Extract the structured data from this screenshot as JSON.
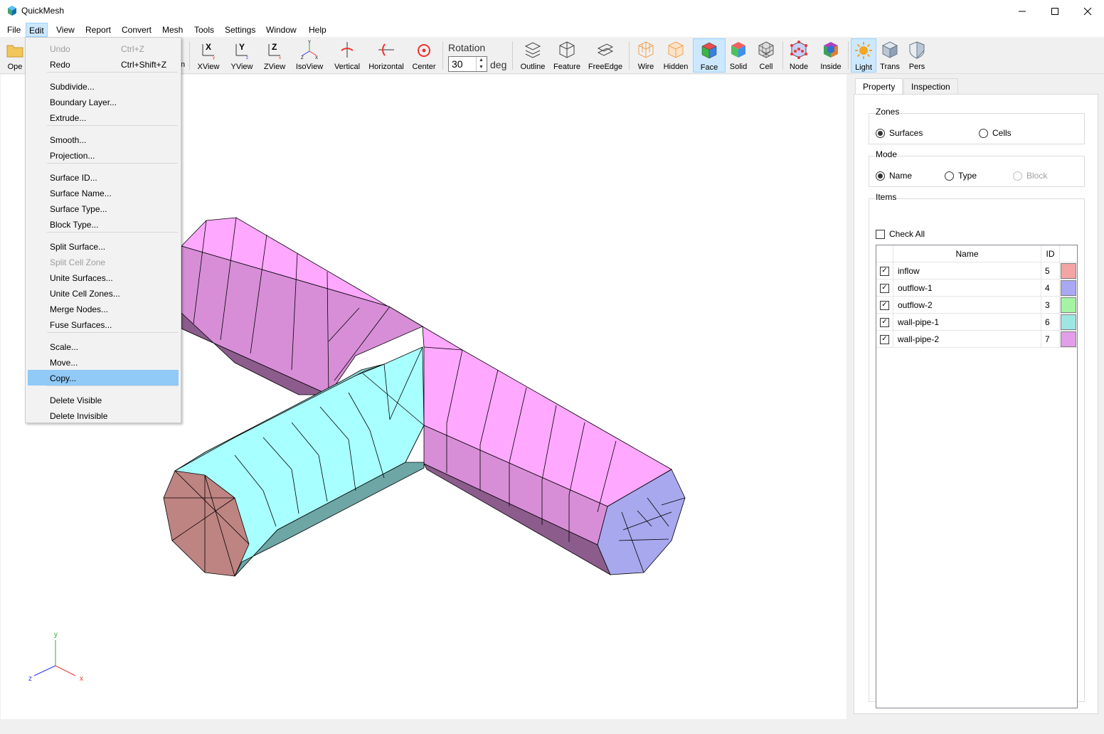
{
  "window": {
    "title": "QuickMesh",
    "controls": [
      "minimize",
      "maximize",
      "close"
    ]
  },
  "menubar": [
    "File",
    "Edit",
    "View",
    "Report",
    "Convert",
    "Mesh",
    "Tools",
    "Settings",
    "Window",
    "Help"
  ],
  "open_menu": "Edit",
  "toolbar": {
    "hidden_open_label": "Ope",
    "hidden_fragment": "n",
    "view_tools": [
      "XView",
      "YView",
      "ZView",
      "IsoView",
      "Vertical",
      "Horizontal",
      "Center"
    ],
    "rotation": {
      "label": "Rotation",
      "value": "30",
      "unit": "deg"
    },
    "display_tools": [
      "Outline",
      "Feature",
      "FreeEdge",
      "Wire",
      "Hidden",
      "Face",
      "Solid",
      "Cell",
      "Node",
      "Inside",
      "Light",
      "Trans",
      "Pers"
    ],
    "active_tools": [
      "Face",
      "Light"
    ]
  },
  "edit_menu": {
    "items": [
      {
        "label": "Undo",
        "shortcut": "Ctrl+Z",
        "disabled": true
      },
      {
        "label": "Redo",
        "shortcut": "Ctrl+Shift+Z"
      },
      {
        "label": "Subdivide..."
      },
      {
        "label": "Boundary Layer..."
      },
      {
        "label": "Extrude..."
      },
      {
        "label": "Smooth..."
      },
      {
        "label": "Projection..."
      },
      {
        "label": "Surface ID..."
      },
      {
        "label": "Surface Name..."
      },
      {
        "label": "Surface Type..."
      },
      {
        "label": "Block Type..."
      },
      {
        "label": "Split Surface..."
      },
      {
        "label": "Split Cell Zone",
        "disabled": true
      },
      {
        "label": "Unite Surfaces..."
      },
      {
        "label": "Unite Cell Zones..."
      },
      {
        "label": "Merge Nodes..."
      },
      {
        "label": "Fuse Surfaces..."
      },
      {
        "label": "Scale..."
      },
      {
        "label": "Move..."
      },
      {
        "label": "Copy...",
        "highlighted": true
      },
      {
        "label": "Delete Visible"
      },
      {
        "label": "Delete Invisible"
      }
    ]
  },
  "panel": {
    "tabs": [
      "Property",
      "Inspection"
    ],
    "active_tab": "Property",
    "zones": {
      "title": "Zones",
      "options": [
        "Surfaces",
        "Cells"
      ],
      "selected": "Surfaces"
    },
    "mode": {
      "title": "Mode",
      "options": [
        "Name",
        "Type",
        "Block"
      ],
      "selected": "Name",
      "disabled": [
        "Block"
      ]
    },
    "items": {
      "title": "Items",
      "check_all": "Check All",
      "check_all_checked": false,
      "columns": [
        "Name",
        "ID"
      ],
      "rows": [
        {
          "name": "inflow",
          "id": "5",
          "checked": true,
          "color": "#f4a4a4"
        },
        {
          "name": "outflow-1",
          "id": "4",
          "checked": true,
          "color": "#a8a8f4"
        },
        {
          "name": "outflow-2",
          "id": "3",
          "checked": true,
          "color": "#a4f4a4"
        },
        {
          "name": "wall-pipe-1",
          "id": "6",
          "checked": true,
          "color": "#9ee6e2"
        },
        {
          "name": "wall-pipe-2",
          "id": "7",
          "checked": true,
          "color": "#e29ee8"
        }
      ]
    }
  },
  "axes": {
    "y": "y",
    "z": "z",
    "x": "x"
  },
  "colors": {
    "accent": "#cce8ff",
    "menu_highlight": "#91c9f7",
    "pipe2_light": "#ffa8ff",
    "pipe2_mid": "#d78ed7",
    "pipe2_dark": "#8c5c8c",
    "pipe1_light": "#a8ffff",
    "pipe1_mid": "#8cd6d6",
    "pipe1_dark": "#6ea6a6",
    "inflow": "#be8482",
    "outflow": "#a8a8ee"
  }
}
